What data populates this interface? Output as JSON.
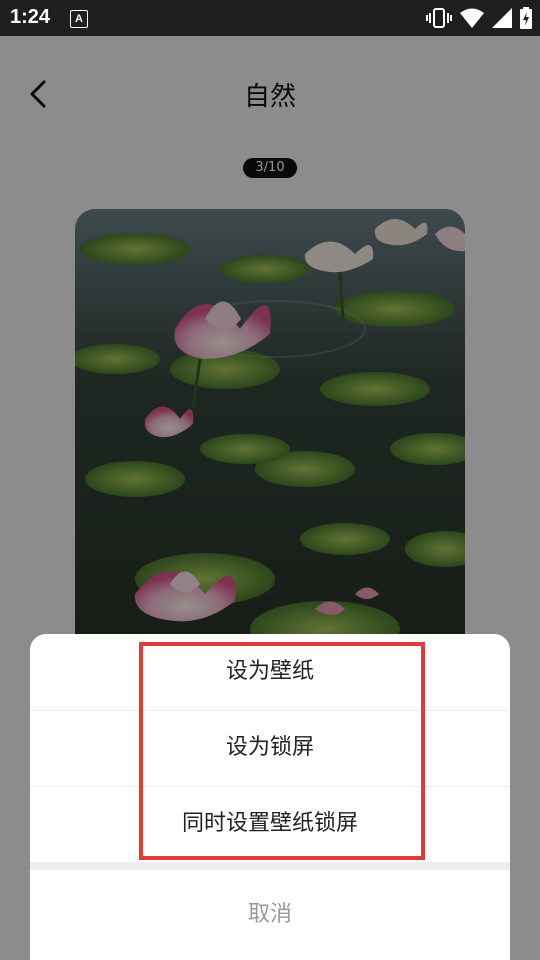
{
  "status_bar": {
    "time": "1:24",
    "notification_icon_letter": "A",
    "icons": [
      "vibrate-icon",
      "wifi-icon",
      "cellular-signal-icon",
      "battery-charging-icon"
    ]
  },
  "header": {
    "back_icon": "chevron-left-icon",
    "title": "自然"
  },
  "pager": {
    "indicator": "3/10"
  },
  "wallpaper": {
    "subject": "lotus pond",
    "colors": [
      "#2d3a2a",
      "#5c7a3a",
      "#e48fb0"
    ]
  },
  "action_sheet": {
    "items": [
      {
        "label": "设为壁纸"
      },
      {
        "label": "设为锁屏"
      },
      {
        "label": "同时设置壁纸锁屏"
      }
    ],
    "cancel_label": "取消"
  },
  "annotation": {
    "color": "#e03a3a"
  }
}
